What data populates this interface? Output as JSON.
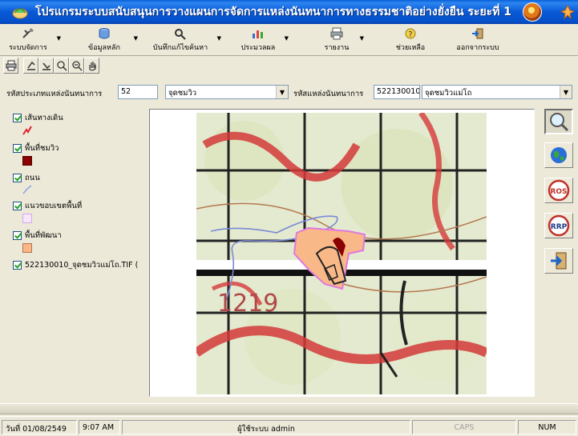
{
  "window": {
    "title": "โปรแกรมระบบสนับสนุนการวางแผนการจัดการแหล่งนันทนาการทางธรรมชาติอย่างยั่งยืน ระยะที่ 1"
  },
  "menu": [
    {
      "label": "ระบบจัดการ",
      "icon": "tools-icon",
      "dropdown": true
    },
    {
      "label": "ข้อมูลหลัก",
      "icon": "database-icon",
      "dropdown": true
    },
    {
      "label": "บันทึกแก้ไขค้นหา",
      "icon": "edit-search-icon",
      "dropdown": true
    },
    {
      "label": "ประมวลผล",
      "icon": "chart-icon",
      "dropdown": true
    },
    {
      "label": "รายงาน",
      "icon": "printer-icon",
      "dropdown": true
    },
    {
      "label": "ช่วยเหลือ",
      "icon": "help-icon",
      "dropdown": false
    },
    {
      "label": "ออกจากระบบ",
      "icon": "exit-icon",
      "dropdown": false
    }
  ],
  "form": {
    "type_label": "รหัสประเภทแหล่งนันทนาการ",
    "type_code": "52",
    "type_name": "จุดชมวิว",
    "site_label": "รหัสแหล่งนันทนาการ",
    "site_code": "522130010",
    "site_name": "จุดชมวิวแม่โถ"
  },
  "layers": [
    {
      "name": "เส้นทางเดิน",
      "checked": true,
      "symbol": "line-red"
    },
    {
      "name": "พื้นที่ชมวิว",
      "checked": true,
      "symbol": "fill-darkred"
    },
    {
      "name": "ถนน",
      "checked": true,
      "symbol": "line-lightblue"
    },
    {
      "name": "แนวขอบเขตพื้นที่",
      "checked": true,
      "symbol": "fill-lavender"
    },
    {
      "name": "พื้นที่พัฒนา",
      "checked": true,
      "symbol": "fill-peach"
    },
    {
      "name": "522130010_จุดชมวิวแม่โถ.TIF (",
      "checked": true,
      "symbol": "raster"
    }
  ],
  "map": {
    "label_text": "1219"
  },
  "right_tools": [
    {
      "name": "zoom-extent-icon",
      "label": ""
    },
    {
      "name": "globe-icon",
      "label": ""
    },
    {
      "name": "ros-icon",
      "label": "ROS"
    },
    {
      "name": "rrp-icon",
      "label": "RRP"
    },
    {
      "name": "exit-door-icon",
      "label": ""
    }
  ],
  "status": {
    "date": "วันที่ 01/08/2549",
    "time": "9:07 AM",
    "user": "ผู้ใช้ระบบ admin",
    "caps": "CAPS",
    "num": "NUM"
  },
  "colors": {
    "titlebar": "#0858d6",
    "trail": "#e0202a",
    "viewpoint": "#8b0000",
    "road": "#8aa6e8",
    "boundary": "#e8c8f0",
    "development": "#f8b888"
  }
}
